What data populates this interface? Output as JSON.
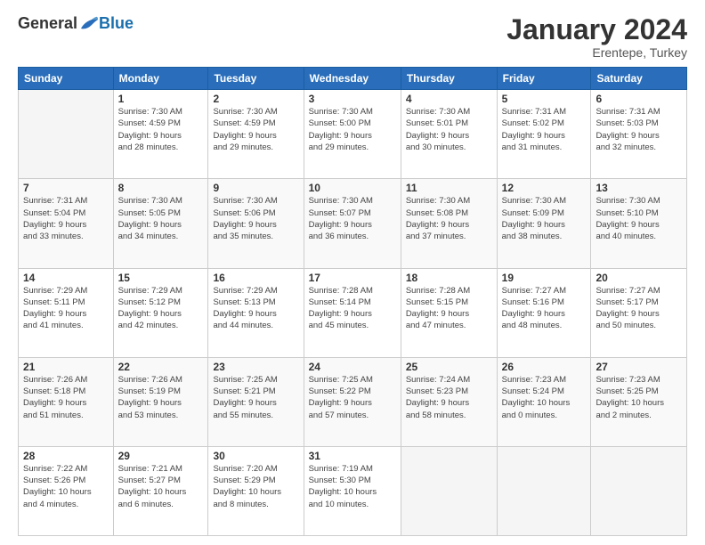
{
  "logo": {
    "general": "General",
    "blue": "Blue"
  },
  "title": "January 2024",
  "location": "Erentepe, Turkey",
  "days_header": [
    "Sunday",
    "Monday",
    "Tuesday",
    "Wednesday",
    "Thursday",
    "Friday",
    "Saturday"
  ],
  "weeks": [
    [
      {
        "day": "",
        "info": ""
      },
      {
        "day": "1",
        "info": "Sunrise: 7:30 AM\nSunset: 4:59 PM\nDaylight: 9 hours\nand 28 minutes."
      },
      {
        "day": "2",
        "info": "Sunrise: 7:30 AM\nSunset: 4:59 PM\nDaylight: 9 hours\nand 29 minutes."
      },
      {
        "day": "3",
        "info": "Sunrise: 7:30 AM\nSunset: 5:00 PM\nDaylight: 9 hours\nand 29 minutes."
      },
      {
        "day": "4",
        "info": "Sunrise: 7:30 AM\nSunset: 5:01 PM\nDaylight: 9 hours\nand 30 minutes."
      },
      {
        "day": "5",
        "info": "Sunrise: 7:31 AM\nSunset: 5:02 PM\nDaylight: 9 hours\nand 31 minutes."
      },
      {
        "day": "6",
        "info": "Sunrise: 7:31 AM\nSunset: 5:03 PM\nDaylight: 9 hours\nand 32 minutes."
      }
    ],
    [
      {
        "day": "7",
        "info": "Sunrise: 7:31 AM\nSunset: 5:04 PM\nDaylight: 9 hours\nand 33 minutes."
      },
      {
        "day": "8",
        "info": "Sunrise: 7:30 AM\nSunset: 5:05 PM\nDaylight: 9 hours\nand 34 minutes."
      },
      {
        "day": "9",
        "info": "Sunrise: 7:30 AM\nSunset: 5:06 PM\nDaylight: 9 hours\nand 35 minutes."
      },
      {
        "day": "10",
        "info": "Sunrise: 7:30 AM\nSunset: 5:07 PM\nDaylight: 9 hours\nand 36 minutes."
      },
      {
        "day": "11",
        "info": "Sunrise: 7:30 AM\nSunset: 5:08 PM\nDaylight: 9 hours\nand 37 minutes."
      },
      {
        "day": "12",
        "info": "Sunrise: 7:30 AM\nSunset: 5:09 PM\nDaylight: 9 hours\nand 38 minutes."
      },
      {
        "day": "13",
        "info": "Sunrise: 7:30 AM\nSunset: 5:10 PM\nDaylight: 9 hours\nand 40 minutes."
      }
    ],
    [
      {
        "day": "14",
        "info": "Sunrise: 7:29 AM\nSunset: 5:11 PM\nDaylight: 9 hours\nand 41 minutes."
      },
      {
        "day": "15",
        "info": "Sunrise: 7:29 AM\nSunset: 5:12 PM\nDaylight: 9 hours\nand 42 minutes."
      },
      {
        "day": "16",
        "info": "Sunrise: 7:29 AM\nSunset: 5:13 PM\nDaylight: 9 hours\nand 44 minutes."
      },
      {
        "day": "17",
        "info": "Sunrise: 7:28 AM\nSunset: 5:14 PM\nDaylight: 9 hours\nand 45 minutes."
      },
      {
        "day": "18",
        "info": "Sunrise: 7:28 AM\nSunset: 5:15 PM\nDaylight: 9 hours\nand 47 minutes."
      },
      {
        "day": "19",
        "info": "Sunrise: 7:27 AM\nSunset: 5:16 PM\nDaylight: 9 hours\nand 48 minutes."
      },
      {
        "day": "20",
        "info": "Sunrise: 7:27 AM\nSunset: 5:17 PM\nDaylight: 9 hours\nand 50 minutes."
      }
    ],
    [
      {
        "day": "21",
        "info": "Sunrise: 7:26 AM\nSunset: 5:18 PM\nDaylight: 9 hours\nand 51 minutes."
      },
      {
        "day": "22",
        "info": "Sunrise: 7:26 AM\nSunset: 5:19 PM\nDaylight: 9 hours\nand 53 minutes."
      },
      {
        "day": "23",
        "info": "Sunrise: 7:25 AM\nSunset: 5:21 PM\nDaylight: 9 hours\nand 55 minutes."
      },
      {
        "day": "24",
        "info": "Sunrise: 7:25 AM\nSunset: 5:22 PM\nDaylight: 9 hours\nand 57 minutes."
      },
      {
        "day": "25",
        "info": "Sunrise: 7:24 AM\nSunset: 5:23 PM\nDaylight: 9 hours\nand 58 minutes."
      },
      {
        "day": "26",
        "info": "Sunrise: 7:23 AM\nSunset: 5:24 PM\nDaylight: 10 hours\nand 0 minutes."
      },
      {
        "day": "27",
        "info": "Sunrise: 7:23 AM\nSunset: 5:25 PM\nDaylight: 10 hours\nand 2 minutes."
      }
    ],
    [
      {
        "day": "28",
        "info": "Sunrise: 7:22 AM\nSunset: 5:26 PM\nDaylight: 10 hours\nand 4 minutes."
      },
      {
        "day": "29",
        "info": "Sunrise: 7:21 AM\nSunset: 5:27 PM\nDaylight: 10 hours\nand 6 minutes."
      },
      {
        "day": "30",
        "info": "Sunrise: 7:20 AM\nSunset: 5:29 PM\nDaylight: 10 hours\nand 8 minutes."
      },
      {
        "day": "31",
        "info": "Sunrise: 7:19 AM\nSunset: 5:30 PM\nDaylight: 10 hours\nand 10 minutes."
      },
      {
        "day": "",
        "info": ""
      },
      {
        "day": "",
        "info": ""
      },
      {
        "day": "",
        "info": ""
      }
    ]
  ]
}
